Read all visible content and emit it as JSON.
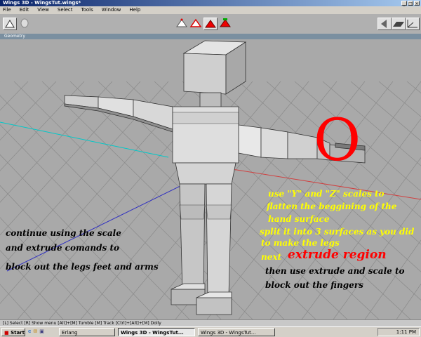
{
  "window": {
    "title": "Wings 3D - WingsTut.wings*"
  },
  "menu": [
    "File",
    "Edit",
    "View",
    "Select",
    "Tools",
    "Window",
    "Help"
  ],
  "geometry_label": "Geometry",
  "big_letter": "O",
  "notes": {
    "left_1": "continue using the scale",
    "left_2": "and extrude comands to",
    "left_3": "block out the legs feet and arms",
    "r1": "use \"Y\" and \"Z\" scales to",
    "r2": "flatten the beggining of the",
    "r3": "hand surface",
    "r4": "split it into 3 surfaces as you did",
    "r5": "to make the legs",
    "r6_next": "next",
    "r6_big": "extrude region",
    "r7": "then use extrude and scale to",
    "r8": "block out the fingers"
  },
  "status": "[L] Select  [R] Show menu  [Alt]+[M] Tumble  [M] Track  [Ctrl]+[Alt]+[M] Dolly",
  "taskbar": {
    "start": "Start",
    "tasks": [
      "Erlang",
      "Wings 3D - WingsTut...",
      "Wings 3D - WingsTut..."
    ],
    "clock": "1:11 PM"
  },
  "colors": {
    "accent_red": "#ff0000",
    "note_yellow": "#ffff00",
    "note_black": "#000000"
  }
}
